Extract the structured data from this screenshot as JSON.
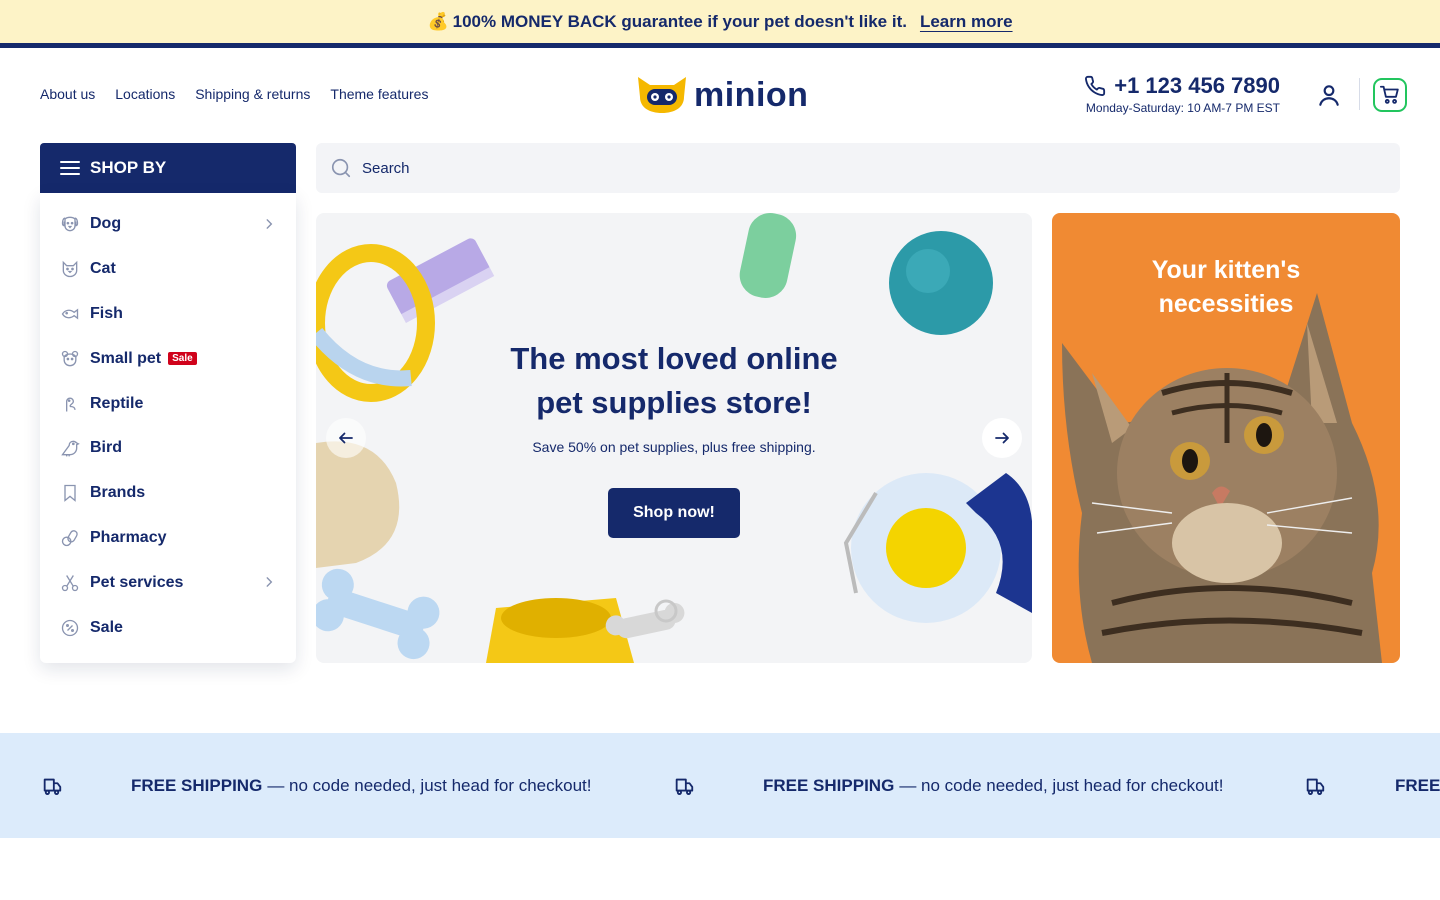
{
  "announcement": {
    "icon": "money-bag-icon",
    "text": "100% MONEY BACK guarantee if your pet doesn't like it.",
    "link": "Learn more"
  },
  "header": {
    "nav": [
      "About us",
      "Locations",
      "Shipping & returns",
      "Theme features"
    ],
    "logo_text": "minion",
    "phone": "+1 123 456 7890",
    "hours": "Monday-Saturday: 10 AM-7 PM EST"
  },
  "sidebar": {
    "title": "SHOP BY",
    "items": [
      {
        "label": "Dog",
        "icon": "dog-icon",
        "has_submenu": true
      },
      {
        "label": "Cat",
        "icon": "cat-icon",
        "has_submenu": false
      },
      {
        "label": "Fish",
        "icon": "fish-icon",
        "has_submenu": false
      },
      {
        "label": "Small pet",
        "icon": "small-pet-icon",
        "has_submenu": false,
        "badge": "Sale"
      },
      {
        "label": "Reptile",
        "icon": "reptile-icon",
        "has_submenu": false
      },
      {
        "label": "Bird",
        "icon": "bird-icon",
        "has_submenu": false
      },
      {
        "label": "Brands",
        "icon": "bookmark-icon",
        "has_submenu": false
      },
      {
        "label": "Pharmacy",
        "icon": "pharmacy-icon",
        "has_submenu": false
      },
      {
        "label": "Pet services",
        "icon": "scissors-icon",
        "has_submenu": true
      },
      {
        "label": "Sale",
        "icon": "percent-icon",
        "has_submenu": false
      }
    ]
  },
  "search": {
    "placeholder": "Search"
  },
  "hero": {
    "title_line1": "The most loved online",
    "title_line2": "pet supplies store!",
    "subtitle": "Save 50% on pet supplies, plus free shipping.",
    "button": "Shop now!"
  },
  "promo": {
    "title_line1": "Your kitten's",
    "title_line2": "necessities"
  },
  "shipping_strip": {
    "bold": "FREE SHIPPING",
    "text": "— no code needed, just head for checkout!",
    "bold_cut": "FREE"
  },
  "colors": {
    "navy": "#15296b",
    "announcement_bg": "#fdf3c7",
    "promo_orange": "#f08a33",
    "strip_bg": "#dcebfb",
    "cart_green": "#22c55e",
    "sale_red": "#d0021b"
  }
}
